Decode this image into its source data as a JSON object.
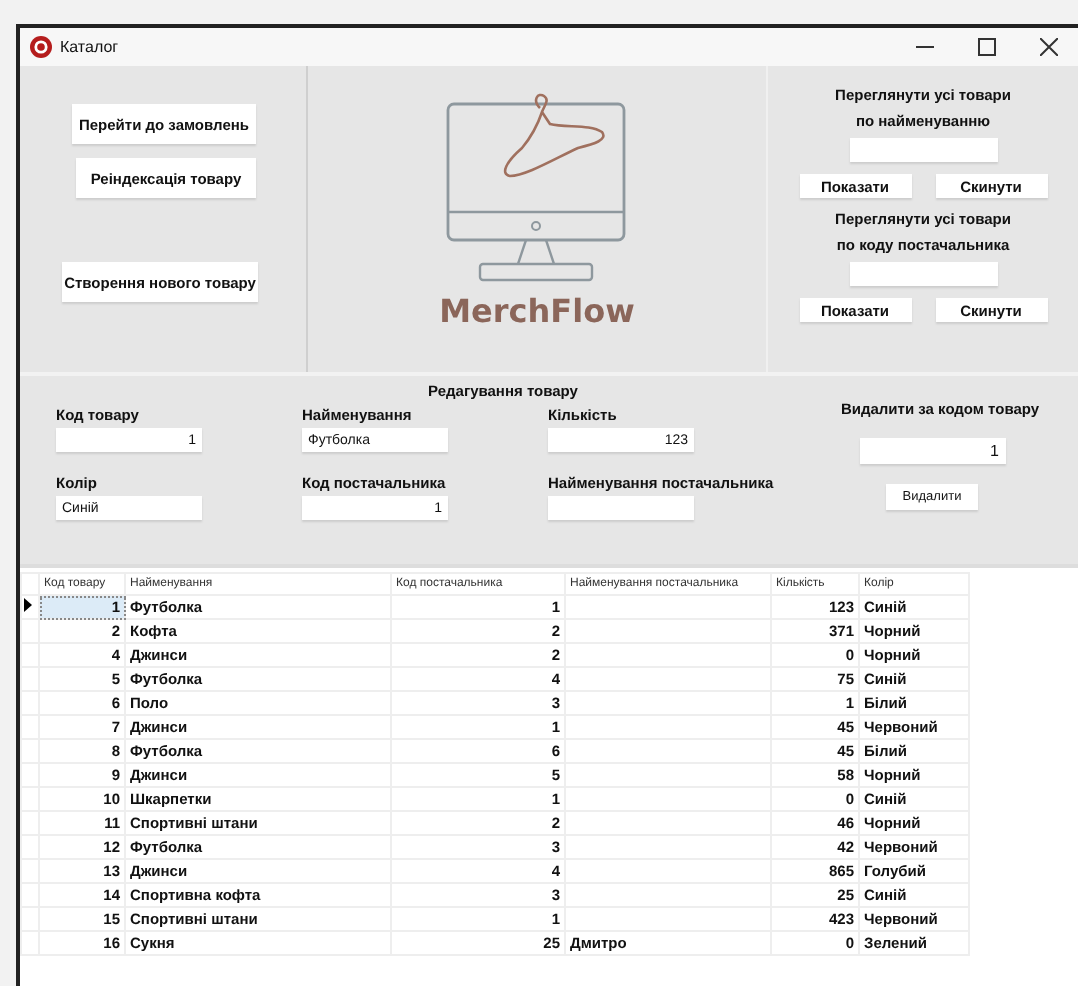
{
  "window": {
    "title": "Каталог"
  },
  "nav_buttons": [
    "Перейти до замовлень",
    "Реіндексація товару",
    "Створення нового товару"
  ],
  "logo": {
    "name": "MerchFlow"
  },
  "filters": [
    {
      "heading": "Переглянути усі товари\nпо найменуванню",
      "buttons": [
        "Показати",
        "Скинути"
      ]
    },
    {
      "heading": "Переглянути усі товари\nпо коду постачальника",
      "buttons": [
        "Показати",
        "Скинути"
      ]
    }
  ],
  "edit": {
    "title": "Редагування товару",
    "fields": [
      {
        "label": "Код товару",
        "value": "1",
        "kind": "number"
      },
      {
        "label": "Найменування",
        "value": "Футболка",
        "kind": "text"
      },
      {
        "label": "Кількість",
        "value": "123",
        "kind": "number"
      },
      {
        "label": "Колір",
        "value": "Синій",
        "kind": "text"
      },
      {
        "label": "Код постачальника",
        "value": "1",
        "kind": "number"
      },
      {
        "label": "Найменування постачальника",
        "kind": "text"
      }
    ]
  },
  "delete": {
    "title": "Видалити за кодом товару",
    "value": "1",
    "button": "Видалити"
  },
  "table": {
    "columns": [
      "Код товару",
      "Найменування",
      "Код постачальника",
      "Найменування постачальника",
      "Кількість",
      "Колір"
    ],
    "rows": [
      {
        "code": "1",
        "name": "Футболка",
        "supplier_code": "1",
        "qty": "123",
        "shade": "Синій",
        "selected": true
      },
      {
        "code": "2",
        "name": "Кофта",
        "supplier_code": "2",
        "qty": "371",
        "shade": "Чорний",
        "selected": false
      },
      {
        "code": "4",
        "name": "Джинси",
        "supplier_code": "2",
        "qty": "0",
        "shade": "Чорний",
        "selected": false
      },
      {
        "code": "5",
        "name": "Футболка",
        "supplier_code": "4",
        "qty": "75",
        "shade": "Синій",
        "selected": false
      },
      {
        "code": "6",
        "name": "Поло",
        "supplier_code": "3",
        "qty": "1",
        "shade": "Білий",
        "selected": false
      },
      {
        "code": "7",
        "name": "Джинси",
        "supplier_code": "1",
        "qty": "45",
        "shade": "Червоний",
        "selected": false
      },
      {
        "code": "8",
        "name": "Футболка",
        "supplier_code": "6",
        "qty": "45",
        "shade": "Білий",
        "selected": false
      },
      {
        "code": "9",
        "name": "Джинси",
        "supplier_code": "5",
        "qty": "58",
        "shade": "Чорний",
        "selected": false
      },
      {
        "code": "10",
        "name": "Шкарпетки",
        "supplier_code": "1",
        "qty": "0",
        "shade": "Синій",
        "selected": false
      },
      {
        "code": "11",
        "name": "Спортивні штани",
        "supplier_code": "2",
        "qty": "46",
        "shade": "Чорний",
        "selected": false
      },
      {
        "code": "12",
        "name": "Футболка",
        "supplier_code": "3",
        "qty": "42",
        "shade": "Червоний",
        "selected": false
      },
      {
        "code": "13",
        "name": "Джинси",
        "supplier_code": "4",
        "qty": "865",
        "shade": "Голубий",
        "selected": false
      },
      {
        "code": "14",
        "name": "Спортивна кофта",
        "supplier_code": "3",
        "qty": "25",
        "shade": "Синій",
        "selected": false
      },
      {
        "code": "15",
        "name": "Спортивні штани",
        "supplier_code": "1",
        "qty": "423",
        "shade": "Червоний",
        "selected": false
      },
      {
        "code": "16",
        "name": "Сукня",
        "supplier_code": "25",
        "supplier_name": "Дмитро",
        "qty": "0",
        "shade": "Зелений",
        "selected": false
      }
    ]
  }
}
